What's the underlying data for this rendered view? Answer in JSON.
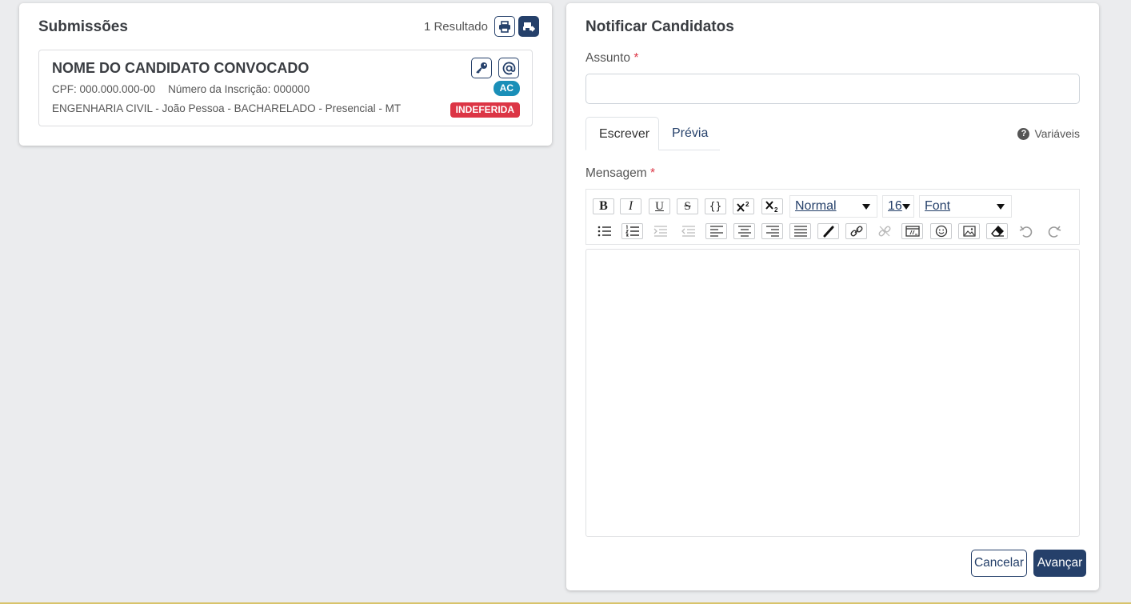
{
  "submissions": {
    "title": "Submissões",
    "result_count": "1 Resultado",
    "icons": {
      "print": "printer-icon",
      "export": "export-icon"
    },
    "items": [
      {
        "name": "NOME DO CANDIDATO CONVOCADO",
        "cpf": "CPF: 000.000.000-00",
        "registration": "Número da Inscrição: 000000",
        "course": "ENGENHARIA CIVIL - João Pessoa - BACHARELADO - Presencial - MT",
        "quota_badge": "AC",
        "status_badge": "INDEFERIDA",
        "icons": {
          "key": "key-icon",
          "email": "at-icon"
        }
      }
    ]
  },
  "notify": {
    "title": "Notificar Candidatos",
    "subject_label": "Assunto",
    "required_mark": "*",
    "subject_value": "",
    "tabs": [
      {
        "label": "Escrever",
        "active": true
      },
      {
        "label": "Prévia",
        "active": false
      }
    ],
    "variables_label": "Variáveis",
    "message_label": "Mensagem",
    "toolbar": {
      "format_buttons": [
        "B",
        "I",
        "U",
        "S",
        "{}"
      ],
      "heading_select": "Normal",
      "size_select": "16",
      "font_select": "Font"
    },
    "message_value": "",
    "cancel_label": "Cancelar",
    "next_label": "Avançar"
  },
  "colors": {
    "primary": "#25406a",
    "danger": "#dc3545",
    "info": "#1a8fb8",
    "background": "#ebecee"
  }
}
